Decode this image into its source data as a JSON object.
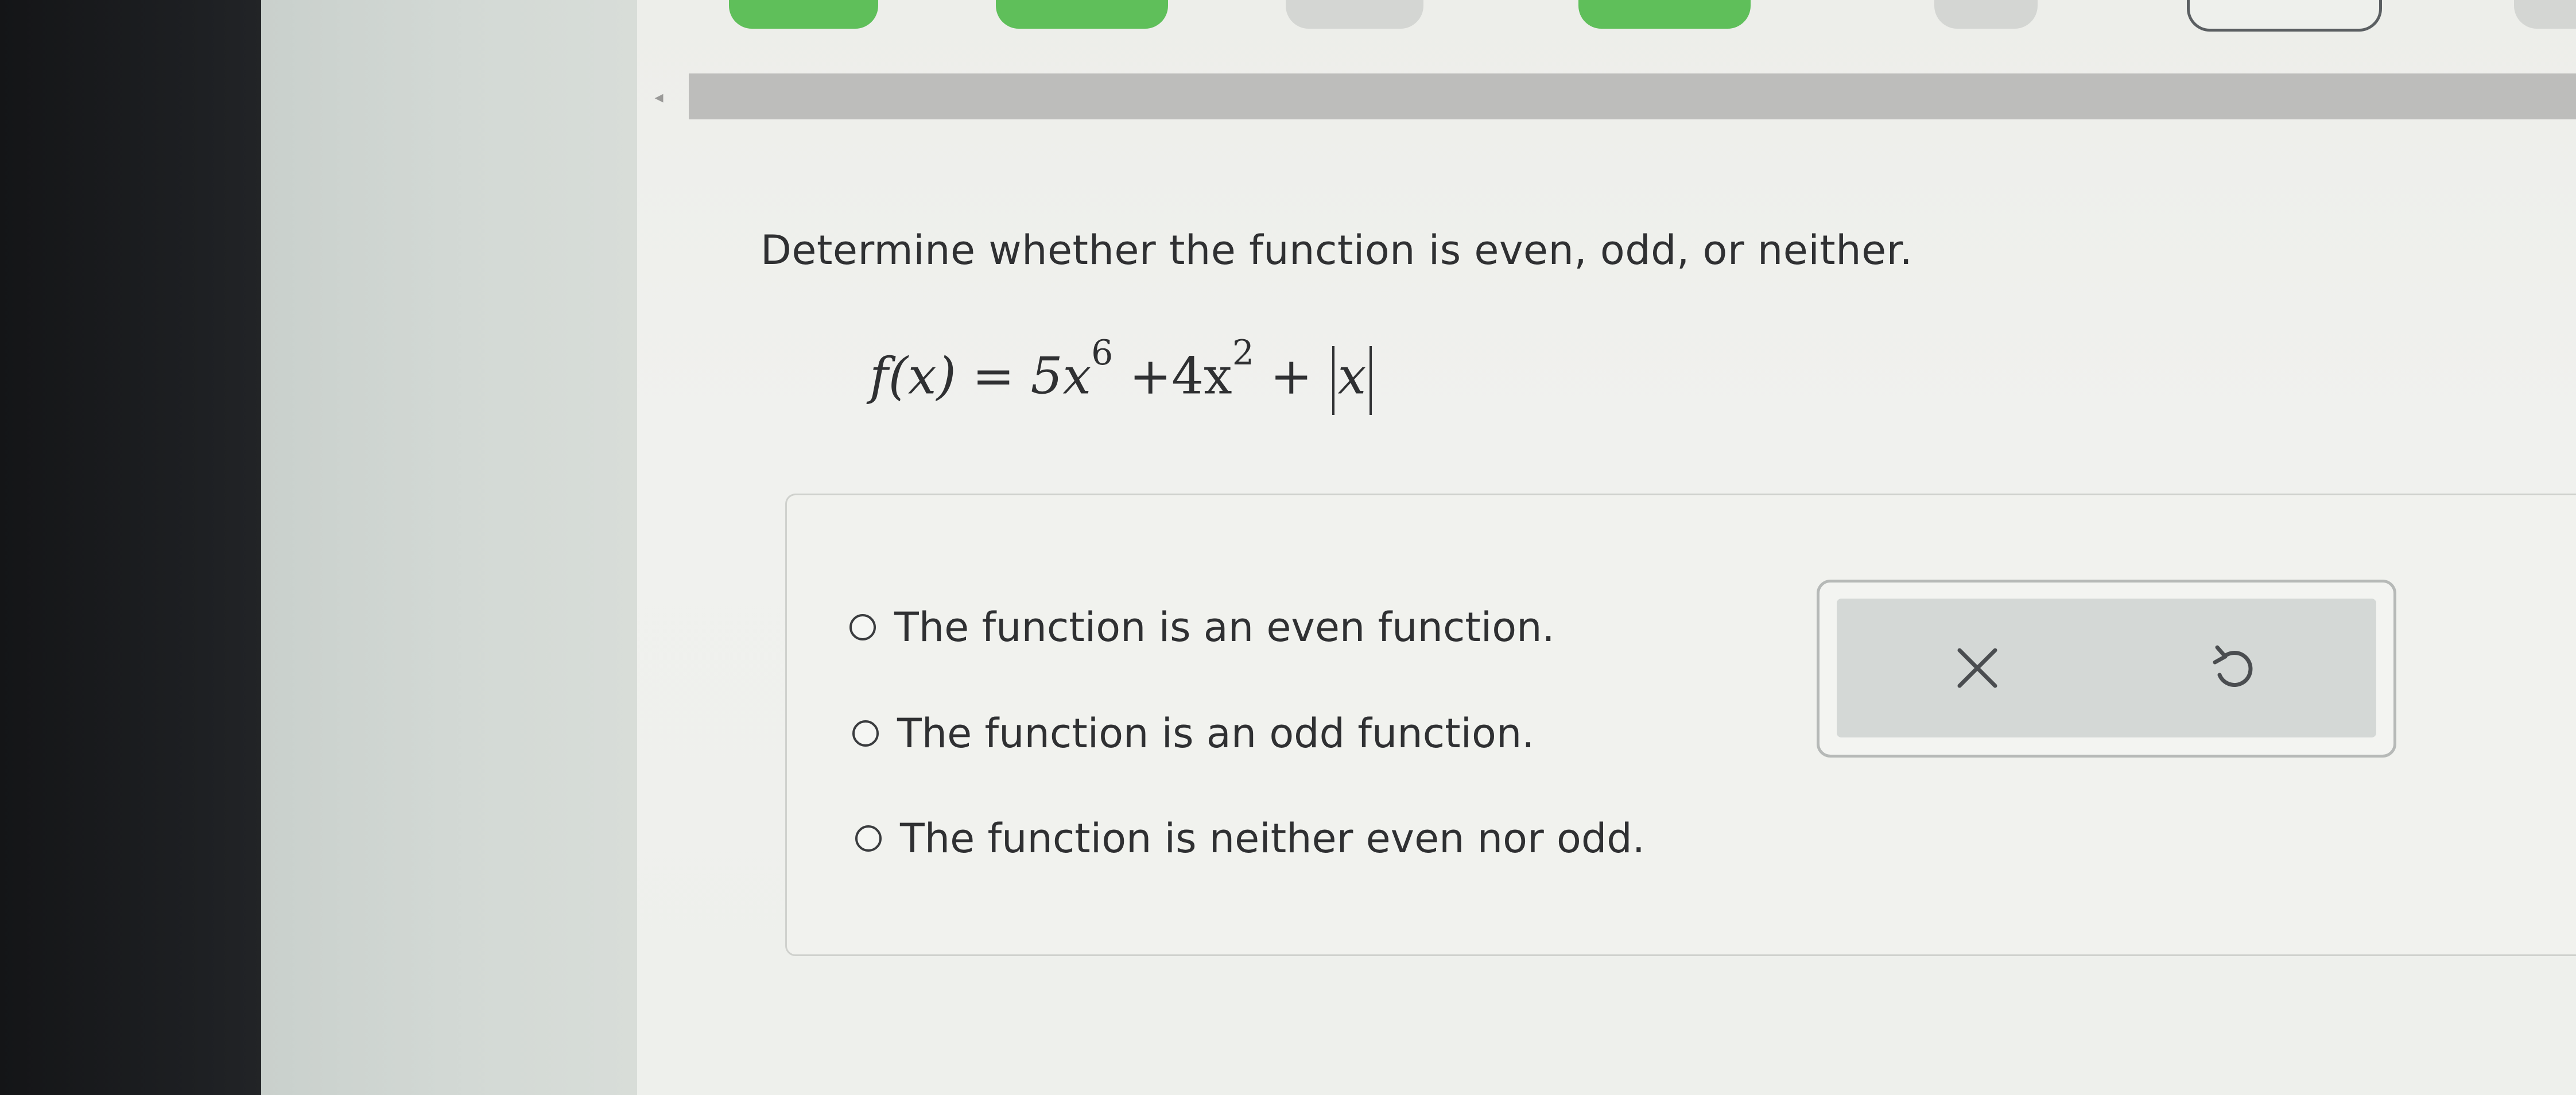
{
  "question": {
    "prompt": "Determine whether the function is even, odd, or neither.",
    "equation": {
      "lhs": "f(x) = 5x",
      "exp1": "6",
      "mid": " +4x",
      "exp2": "2",
      "plus": " + ",
      "abs_arg": "x"
    }
  },
  "options": [
    {
      "label": "The function is an even function."
    },
    {
      "label": "The function is an odd function."
    },
    {
      "label": "The function is neither even nor odd."
    }
  ],
  "tools": {
    "clear_icon": "close-icon",
    "undo_icon": "undo-icon"
  },
  "progress": {
    "tabs": [
      "done",
      "done",
      "pending",
      "done",
      "pending",
      "current",
      "pending"
    ]
  },
  "colors": {
    "done": "#5fbf5a",
    "pending": "#d4d6d3",
    "text": "#2f3032"
  }
}
